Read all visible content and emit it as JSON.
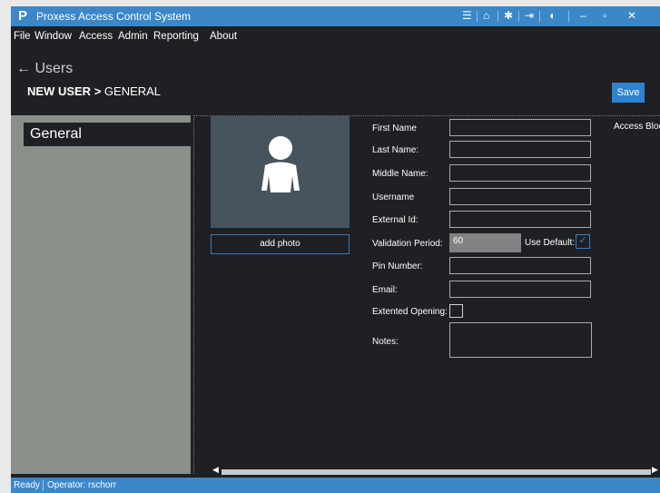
{
  "app": {
    "logo": "P",
    "title": "Proxess Access Control System"
  },
  "titlebar_icons": [
    "hamburger-icon",
    "home-icon",
    "gear-icon",
    "logout-icon",
    "bell-icon",
    "minimize-icon",
    "maximize-icon",
    "close-icon"
  ],
  "menu": {
    "file": "File",
    "window": "Window",
    "access": "Access",
    "admin": "Admin",
    "reporting": "Reporting",
    "about": "About"
  },
  "back_label": "Users",
  "breadcrumb": {
    "main": "NEW USER",
    "sep": ">",
    "sub": "GENERAL"
  },
  "save_label": "Save",
  "sidebar": {
    "items": [
      {
        "label": "General",
        "selected": true
      }
    ]
  },
  "photo": {
    "add_label": "add photo"
  },
  "form": {
    "first_name": "First Name",
    "last_name": "Last Name:",
    "middle_name": "Middle Name:",
    "username": "Username",
    "external_id": "External Id:",
    "validation_period": "Validation Period:",
    "validation_value": "60",
    "use_default": "Use Default:",
    "use_default_checked": true,
    "pin": "Pin Number:",
    "email": "Email:",
    "extended_opening": "Extented Opening:",
    "extended_checked": false,
    "notes": "Notes:"
  },
  "access_block": "Access Block",
  "status": {
    "ready": "Ready",
    "operator": "Operator: rschorr"
  },
  "colors": {
    "accent": "#3b87c7",
    "background": "#1f2023",
    "sidebar": "#8b8f8a"
  }
}
